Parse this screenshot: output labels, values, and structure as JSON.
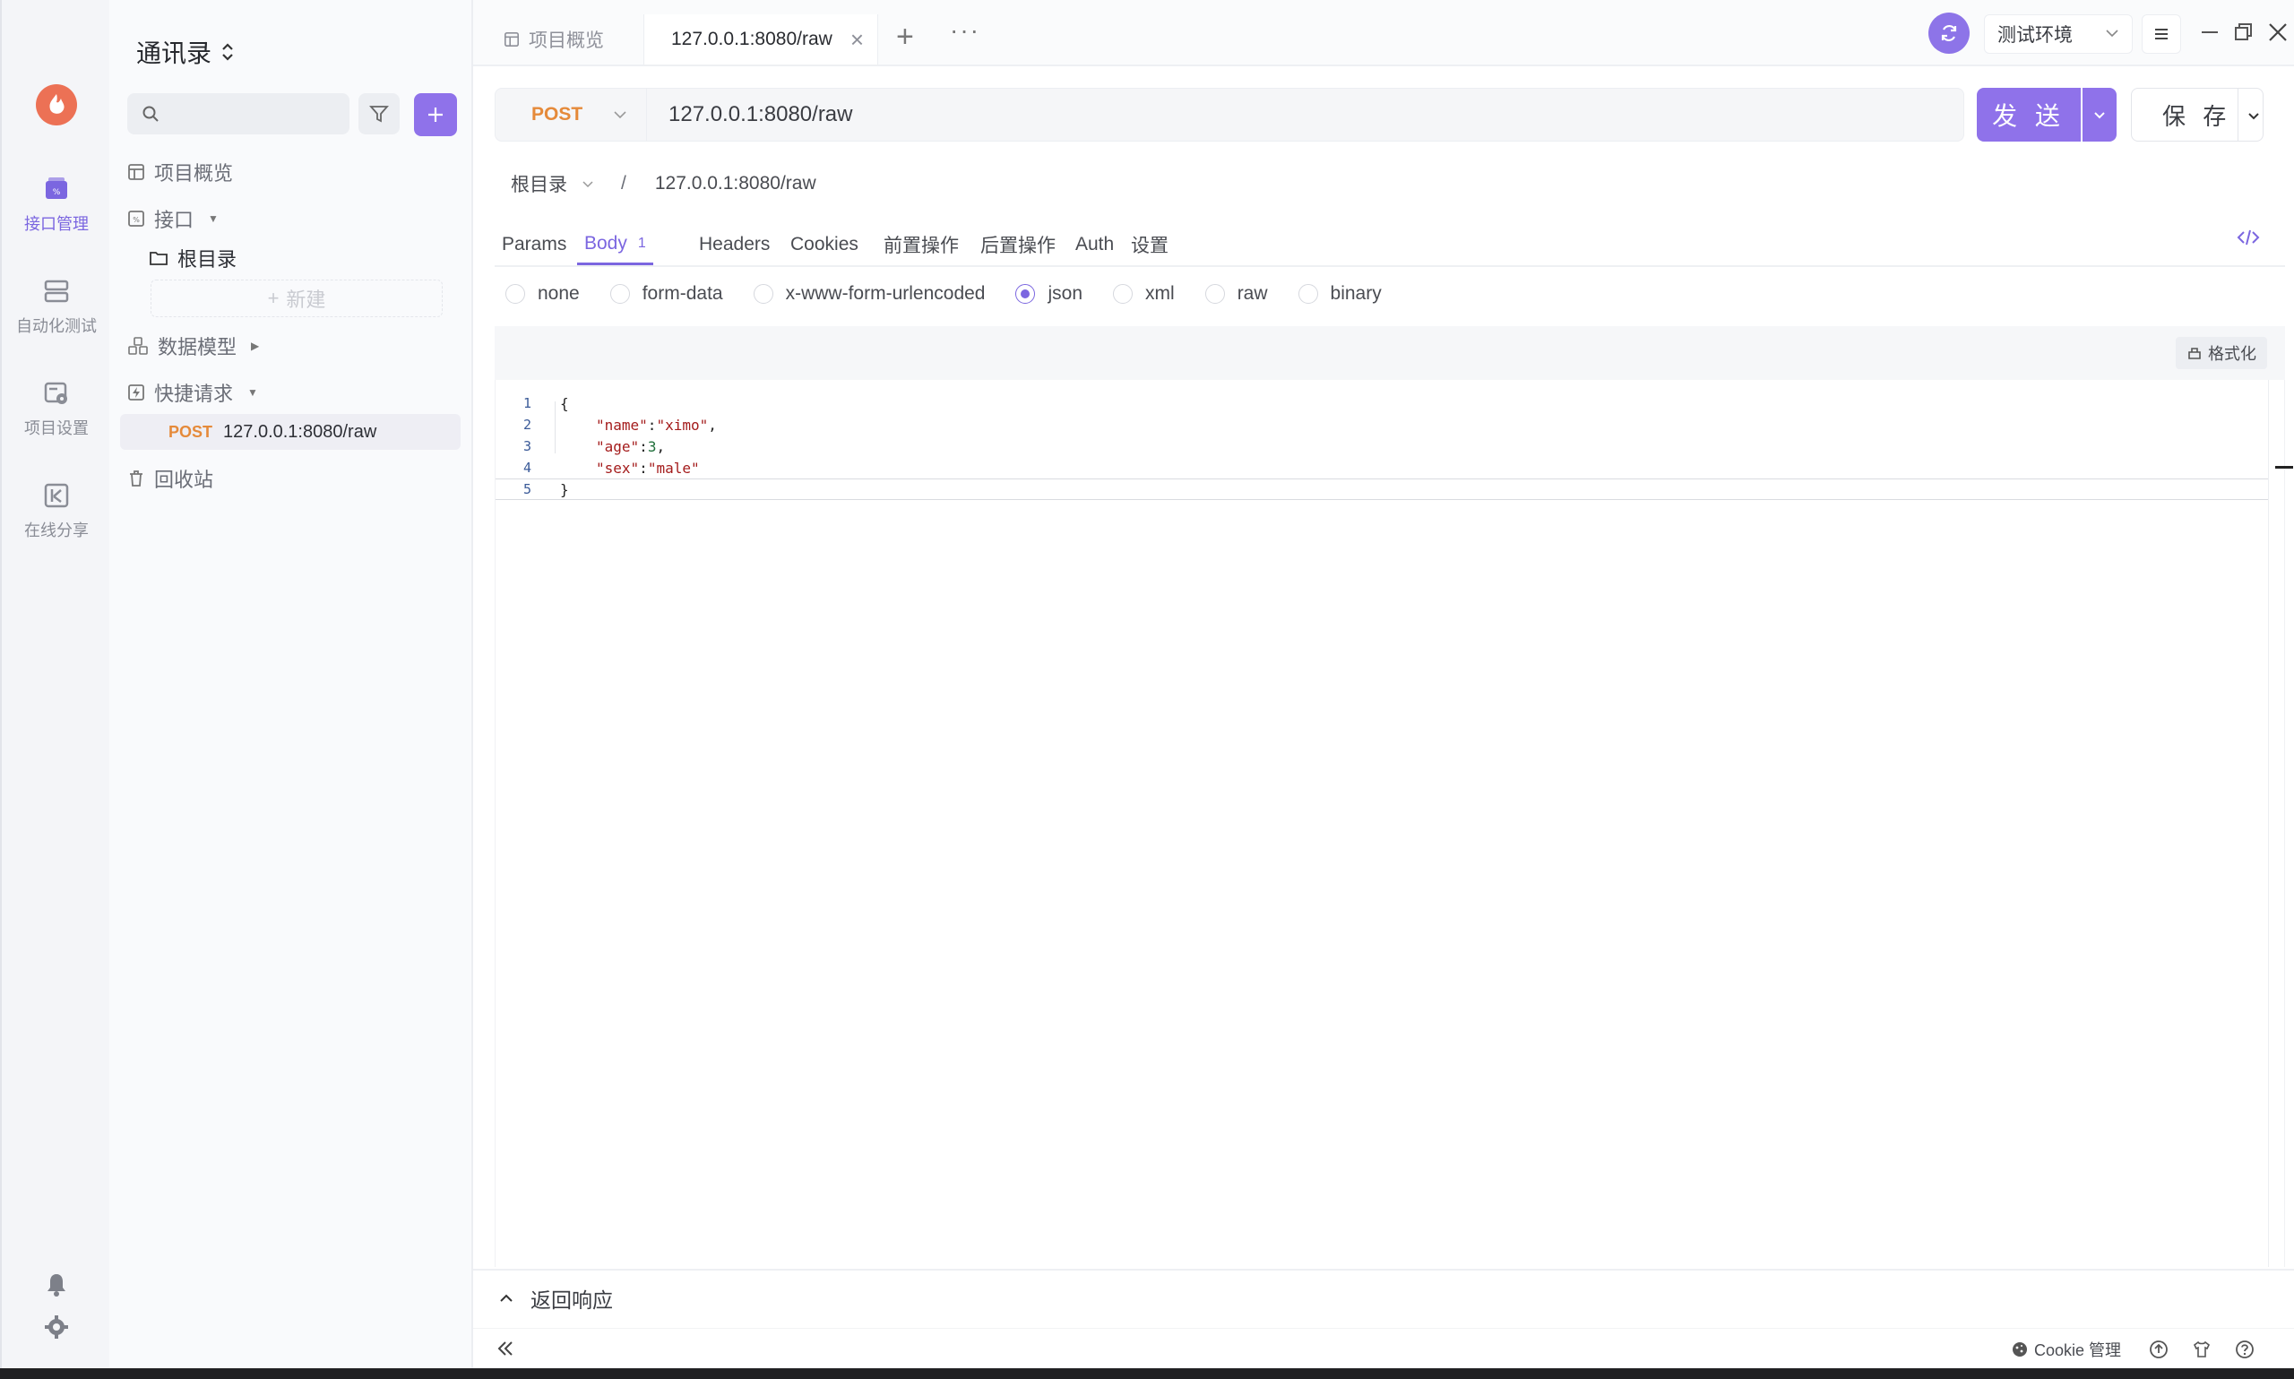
{
  "colors": {
    "accent": "#8f72ea",
    "method_post": "#e58a3a",
    "logo": "#ec7155"
  },
  "rail": {
    "items": [
      {
        "label": "接口管理",
        "icon": "api-management-icon",
        "active": true
      },
      {
        "label": "自动化测试",
        "icon": "automation-test-icon",
        "active": false
      },
      {
        "label": "项目设置",
        "icon": "project-settings-icon",
        "active": false
      },
      {
        "label": "在线分享",
        "icon": "online-share-icon",
        "active": false
      }
    ],
    "bottom_icons": [
      "bell-icon",
      "gear-icon"
    ]
  },
  "tree": {
    "title": "通讯录",
    "search_placeholder": "",
    "items": {
      "overview": "项目概览",
      "api": "接口",
      "root_folder": "根目录",
      "new": "新建",
      "models": "数据模型",
      "quick": "快捷请求",
      "quick_item_method": "POST",
      "quick_item_url": "127.0.0.1:8080/raw",
      "trash": "回收站"
    }
  },
  "tabs": {
    "overview": "项目概览",
    "active": "127.0.0.1:8080/raw",
    "more": "···"
  },
  "env": {
    "label": "测试环境"
  },
  "request": {
    "method": "POST",
    "url": "127.0.0.1:8080/raw",
    "send_label": "发 送",
    "save_label": "保 存"
  },
  "breadcrumb": {
    "root": "根目录",
    "separator": "/",
    "current": "127.0.0.1:8080/raw"
  },
  "req_tabs": {
    "params": "Params",
    "body": "Body",
    "body_count": "1",
    "headers": "Headers",
    "cookies": "Cookies",
    "pre": "前置操作",
    "post": "后置操作",
    "auth": "Auth",
    "settings": "设置"
  },
  "body_types": {
    "options": [
      "none",
      "form-data",
      "x-www-form-urlencoded",
      "json",
      "xml",
      "raw",
      "binary"
    ],
    "selected": "json"
  },
  "editor": {
    "format_label": "格式化",
    "lines": [
      {
        "no": "1",
        "text": "{"
      },
      {
        "no": "2",
        "key": "\"name\"",
        "value": "\"ximo\"",
        "tail": ","
      },
      {
        "no": "3",
        "key": "\"age\"",
        "value": "3",
        "tail": ","
      },
      {
        "no": "4",
        "key": "\"sex\"",
        "value": "\"male\"",
        "tail": ""
      },
      {
        "no": "5",
        "text": "}"
      }
    ]
  },
  "response": {
    "label": "返回响应"
  },
  "status_bar": {
    "cookie_label": "Cookie 管理"
  }
}
